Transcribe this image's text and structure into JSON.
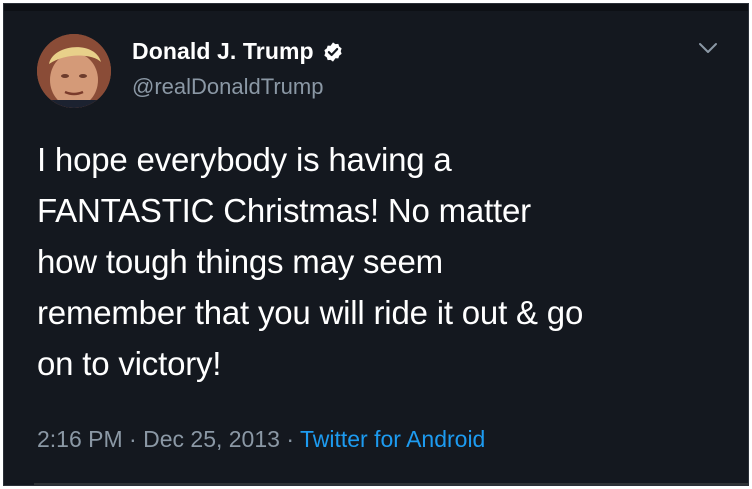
{
  "tweet": {
    "author_name": "Donald J. Trump",
    "handle": "@realDonaldTrump",
    "verified": true,
    "text_lines": [
      "I hope everybody is having a",
      "FANTASTIC Christmas! No matter",
      "how tough things may seem",
      "remember that you will ride it out & go",
      "on to victory!"
    ],
    "time": "2:16 PM",
    "separator": "·",
    "date": "Dec 25, 2013",
    "source": "Twitter for Android"
  },
  "colors": {
    "background": "#14181f",
    "text": "#ffffff",
    "secondary": "#8b98a5",
    "link": "#1d9bf0",
    "verified_badge": "#ffffff"
  },
  "icons": {
    "verified": "verified-badge-icon",
    "menu": "chevron-down-icon"
  }
}
